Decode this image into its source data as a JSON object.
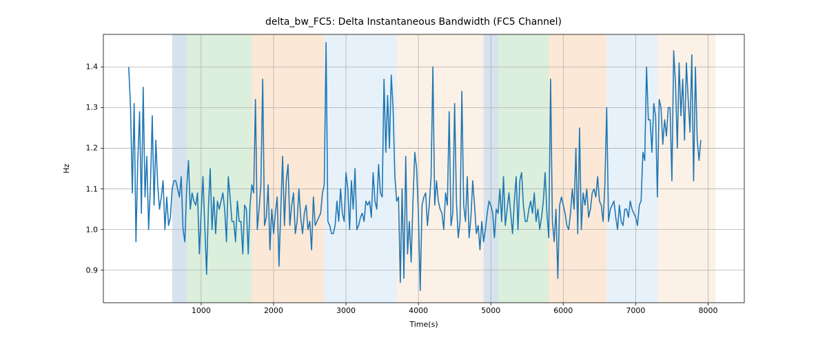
{
  "chart_data": {
    "type": "line",
    "title": "delta_bw_FC5: Delta Instantaneous Bandwidth (FC5 Channel)",
    "xlabel": "Time(s)",
    "ylabel": "Hz",
    "xlim": [
      -350,
      8500
    ],
    "ylim": [
      0.82,
      1.48
    ],
    "xticks": [
      1000,
      2000,
      3000,
      4000,
      5000,
      6000,
      7000,
      8000
    ],
    "yticks": [
      0.9,
      1.0,
      1.1,
      1.2,
      1.3,
      1.4
    ],
    "grid": true,
    "line_color": "#1f77b4",
    "bands": [
      {
        "x0": 600,
        "x1": 800,
        "color": "#5b8db8"
      },
      {
        "x0": 800,
        "x1": 1700,
        "color": "#6fbf73"
      },
      {
        "x0": 1700,
        "x1": 2700,
        "color": "#f5a25d"
      },
      {
        "x0": 2700,
        "x1": 3700,
        "color": "#9ec6e6"
      },
      {
        "x0": 3700,
        "x1": 4900,
        "color": "#f5c89c"
      },
      {
        "x0": 4900,
        "x1": 5100,
        "color": "#5b8db8"
      },
      {
        "x0": 5100,
        "x1": 5800,
        "color": "#6fbf73"
      },
      {
        "x0": 5800,
        "x1": 6600,
        "color": "#f5a25d"
      },
      {
        "x0": 6600,
        "x1": 7300,
        "color": "#9ec6e6"
      },
      {
        "x0": 7300,
        "x1": 8100,
        "color": "#f5c89c"
      }
    ],
    "series": [
      {
        "name": "delta_bw_FC5",
        "x": [
          0,
          25,
          50,
          75,
          100,
          125,
          150,
          175,
          200,
          225,
          250,
          275,
          300,
          325,
          350,
          375,
          400,
          425,
          450,
          475,
          500,
          525,
          550,
          575,
          600,
          625,
          650,
          675,
          700,
          725,
          750,
          775,
          800,
          825,
          850,
          875,
          900,
          925,
          950,
          975,
          1000,
          1025,
          1050,
          1075,
          1100,
          1125,
          1150,
          1175,
          1200,
          1225,
          1250,
          1275,
          1300,
          1325,
          1350,
          1375,
          1400,
          1425,
          1450,
          1475,
          1500,
          1525,
          1550,
          1575,
          1600,
          1625,
          1650,
          1675,
          1700,
          1725,
          1750,
          1775,
          1800,
          1825,
          1850,
          1875,
          1900,
          1925,
          1950,
          1975,
          2000,
          2025,
          2050,
          2075,
          2100,
          2125,
          2150,
          2175,
          2200,
          2225,
          2250,
          2275,
          2300,
          2325,
          2350,
          2375,
          2400,
          2425,
          2450,
          2475,
          2500,
          2525,
          2550,
          2575,
          2600,
          2625,
          2650,
          2675,
          2700,
          2725,
          2750,
          2775,
          2800,
          2825,
          2850,
          2875,
          2900,
          2925,
          2950,
          2975,
          3000,
          3025,
          3050,
          3075,
          3100,
          3125,
          3150,
          3175,
          3200,
          3225,
          3250,
          3275,
          3300,
          3325,
          3350,
          3375,
          3400,
          3425,
          3450,
          3475,
          3500,
          3525,
          3550,
          3575,
          3600,
          3625,
          3650,
          3675,
          3700,
          3725,
          3750,
          3775,
          3800,
          3825,
          3850,
          3875,
          3900,
          3925,
          3950,
          3975,
          4000,
          4025,
          4050,
          4075,
          4100,
          4125,
          4150,
          4175,
          4200,
          4225,
          4250,
          4275,
          4300,
          4325,
          4350,
          4375,
          4400,
          4425,
          4450,
          4475,
          4500,
          4525,
          4550,
          4575,
          4600,
          4625,
          4650,
          4675,
          4700,
          4725,
          4750,
          4775,
          4800,
          4825,
          4850,
          4875,
          4900,
          4925,
          4950,
          4975,
          5000,
          5025,
          5050,
          5075,
          5100,
          5125,
          5150,
          5175,
          5200,
          5225,
          5250,
          5275,
          5300,
          5325,
          5350,
          5375,
          5400,
          5425,
          5450,
          5475,
          5500,
          5525,
          5550,
          5575,
          5600,
          5625,
          5650,
          5675,
          5700,
          5725,
          5750,
          5775,
          5800,
          5825,
          5850,
          5875,
          5900,
          5925,
          5950,
          5975,
          6000,
          6025,
          6050,
          6075,
          6100,
          6125,
          6150,
          6175,
          6200,
          6225,
          6250,
          6275,
          6300,
          6325,
          6350,
          6375,
          6400,
          6425,
          6450,
          6475,
          6500,
          6525,
          6550,
          6575,
          6600,
          6625,
          6650,
          6675,
          6700,
          6725,
          6750,
          6775,
          6800,
          6825,
          6850,
          6875,
          6900,
          6925,
          6950,
          6975,
          7000,
          7025,
          7050,
          7075,
          7100,
          7125,
          7150,
          7175,
          7200,
          7225,
          7250,
          7275,
          7300,
          7325,
          7350,
          7375,
          7400,
          7425,
          7450,
          7475,
          7500,
          7525,
          7550,
          7575,
          7600,
          7625,
          7650,
          7675,
          7700,
          7725,
          7750,
          7775,
          7800,
          7825,
          7850,
          7875,
          7900,
          7925,
          7950,
          7975,
          8000,
          8025,
          8050,
          8075,
          8100,
          8125,
          8150
        ],
        "values": [
          1.4,
          1.3,
          1.09,
          1.31,
          0.97,
          1.17,
          1.29,
          1.04,
          1.35,
          1.08,
          1.18,
          1.0,
          1.11,
          1.28,
          1.06,
          1.22,
          1.11,
          1.05,
          1.08,
          1.12,
          1.0,
          1.08,
          1.01,
          1.03,
          1.1,
          1.12,
          1.12,
          1.1,
          1.08,
          1.13,
          1.0,
          0.97,
          1.1,
          1.17,
          1.05,
          1.09,
          1.07,
          1.06,
          1.09,
          0.94,
          1.04,
          1.13,
          1.01,
          0.89,
          1.05,
          1.15,
          1.0,
          1.08,
          0.99,
          1.07,
          1.05,
          1.07,
          1.09,
          1.05,
          0.97,
          1.13,
          1.08,
          1.02,
          1.02,
          0.97,
          1.07,
          1.02,
          1.02,
          0.94,
          1.06,
          1.05,
          0.94,
          1.06,
          1.11,
          1.09,
          1.32,
          1.0,
          1.05,
          1.11,
          1.37,
          1.01,
          1.03,
          1.11,
          0.95,
          1.05,
          0.99,
          1.04,
          1.08,
          0.91,
          1.05,
          1.18,
          1.01,
          1.12,
          1.16,
          1.01,
          1.06,
          1.09,
          0.99,
          1.02,
          1.1,
          1.03,
          0.99,
          1.04,
          1.06,
          1.0,
          1.02,
          0.95,
          1.08,
          1.01,
          1.02,
          1.03,
          1.04,
          1.09,
          1.11,
          1.46,
          1.02,
          1.01,
          0.99,
          0.99,
          1.01,
          1.07,
          1.02,
          1.1,
          1.04,
          1.02,
          1.14,
          1.1,
          1.0,
          1.12,
          1.05,
          1.15,
          1.0,
          1.01,
          1.03,
          1.04,
          1.02,
          1.07,
          1.06,
          1.07,
          1.03,
          1.14,
          1.07,
          1.05,
          1.16,
          1.09,
          1.08,
          1.37,
          1.19,
          1.33,
          1.2,
          1.38,
          1.3,
          1.13,
          1.07,
          1.08,
          0.87,
          1.1,
          0.88,
          1.18,
          0.94,
          1.02,
          0.92,
          1.07,
          1.19,
          1.15,
          1.04,
          0.85,
          1.06,
          1.08,
          1.09,
          1.01,
          1.06,
          1.13,
          1.4,
          1.06,
          1.12,
          1.07,
          1.05,
          1.04,
          1.0,
          1.09,
          1.06,
          1.29,
          1.01,
          1.04,
          1.31,
          1.07,
          0.98,
          1.02,
          1.34,
          1.06,
          1.02,
          1.13,
          0.98,
          1.03,
          1.12,
          1.06,
          0.99,
          1.01,
          0.95,
          1.02,
          0.97,
          1.0,
          1.04,
          1.07,
          1.06,
          1.04,
          0.98,
          1.05,
          1.04,
          1.1,
          1.02,
          1.13,
          1.01,
          1.05,
          1.09,
          1.04,
          0.99,
          1.07,
          1.13,
          1.0,
          1.12,
          1.14,
          1.06,
          1.02,
          1.02,
          1.05,
          1.07,
          1.04,
          1.09,
          1.02,
          1.05,
          1.0,
          1.03,
          1.07,
          1.14,
          1.04,
          0.98,
          1.37,
          1.02,
          0.97,
          1.05,
          0.88,
          1.06,
          1.08,
          1.06,
          1.04,
          1.01,
          1.0,
          1.04,
          1.1,
          1.05,
          1.2,
          0.99,
          1.25,
          1.0,
          1.09,
          1.06,
          1.1,
          1.03,
          1.05,
          1.09,
          1.1,
          1.08,
          1.13,
          1.07,
          1.06,
          1.02,
          1.11,
          1.3,
          1.02,
          1.05,
          1.06,
          1.07,
          1.03,
          1.0,
          1.06,
          1.02,
          1.01,
          1.05,
          1.05,
          1.03,
          1.07,
          1.05,
          1.04,
          1.03,
          1.01,
          1.06,
          1.07,
          1.19,
          1.17,
          1.4,
          1.27,
          1.27,
          1.19,
          1.31,
          1.28,
          1.08,
          1.32,
          1.3,
          1.21,
          1.27,
          1.23,
          1.3,
          1.3,
          1.12,
          1.44,
          1.36,
          1.2,
          1.41,
          1.28,
          1.37,
          1.22,
          1.41,
          1.32,
          1.24,
          1.43,
          1.12,
          1.4,
          1.22,
          1.17,
          1.22
        ]
      }
    ]
  }
}
